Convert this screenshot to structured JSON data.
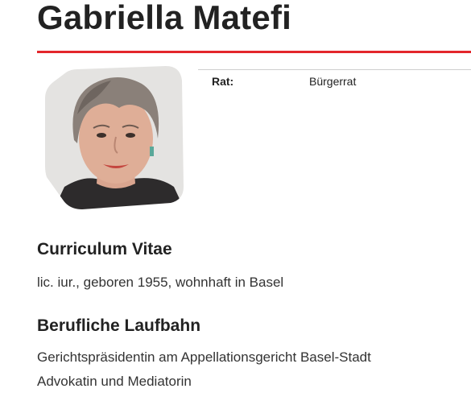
{
  "profile": {
    "name": "Gabriella Matefi",
    "portrait_icon": "person-portrait",
    "accent_color": "#e3262b"
  },
  "info": {
    "label": "Rat:",
    "value": "Bürgerrat"
  },
  "cv": {
    "heading": "Curriculum Vitae",
    "text": "lic. iur., geboren 1955, wohnhaft in Basel"
  },
  "career": {
    "heading": "Berufliche Laufbahn",
    "lines": [
      "Gerichtspräsidentin am Appellationsgericht Basel-Stadt",
      "Advokatin und Mediatorin"
    ]
  }
}
